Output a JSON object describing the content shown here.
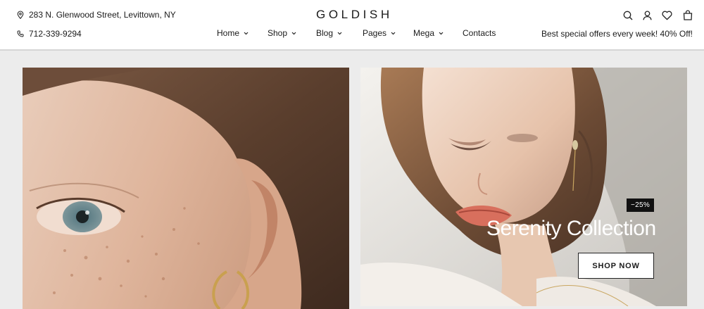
{
  "header": {
    "address": "283 N. Glenwood Street, Levittown, NY",
    "phone": "712-339-9294",
    "logo": "GOLDISH",
    "promo": "Best special offers every week! 40% Off!",
    "nav": [
      {
        "label": "Home",
        "has_dropdown": true
      },
      {
        "label": "Shop",
        "has_dropdown": true
      },
      {
        "label": "Blog",
        "has_dropdown": true
      },
      {
        "label": "Pages",
        "has_dropdown": true
      },
      {
        "label": "Mega",
        "has_dropdown": true
      },
      {
        "label": "Contacts",
        "has_dropdown": false
      }
    ],
    "icons": [
      "search-icon",
      "account-icon",
      "wishlist-icon",
      "cart-icon"
    ]
  },
  "hero": {
    "right_card": {
      "badge": "−25%",
      "title": "Serenity Collection",
      "button": "SHOP NOW"
    }
  },
  "colors": {
    "background": "#ececec",
    "header": "#ffffff",
    "badge": "#111111",
    "text": "#1a1a1a"
  }
}
